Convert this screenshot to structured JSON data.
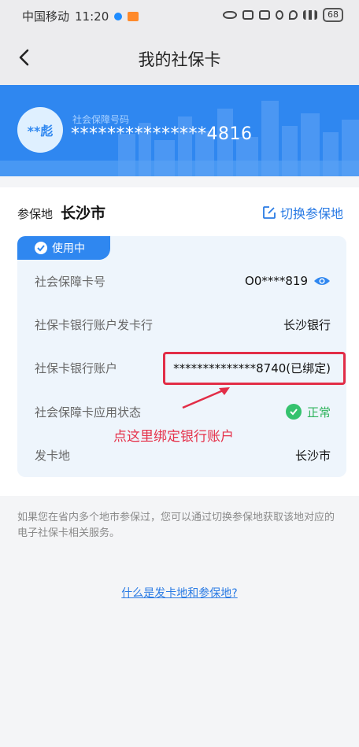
{
  "status_bar": {
    "carrier": "中国移动",
    "time": "11:20",
    "battery": "68"
  },
  "nav": {
    "title": "我的社保卡"
  },
  "banner": {
    "avatar_text": "**彪",
    "card_label": "社会保障号码",
    "card_number": "***************4816"
  },
  "insured_place": {
    "label": "参保地",
    "city": "长沙市",
    "switch_label": "切换参保地"
  },
  "card": {
    "status_tag": "使用中",
    "rows": [
      {
        "key": "社会保障卡号",
        "value": "O0****819"
      },
      {
        "key": "社保卡银行账户发卡行",
        "value": "长沙银行"
      },
      {
        "key": "社保卡银行账户",
        "value": "**************8740(已绑定)"
      },
      {
        "key": "社会保障卡应用状态",
        "value": "正常"
      },
      {
        "key": "发卡地",
        "value": "长沙市"
      }
    ]
  },
  "annotation": {
    "text": "点这里绑定银行账户",
    "color": "#e5314a"
  },
  "note": "如果您在省内多个地市参保过，您可以通过切换参保地获取该地对应的电子社保卡相关服务。",
  "help_link": "什么是发卡地和参保地?",
  "colors": {
    "primary": "#2f87f0",
    "link": "#2a7be4",
    "success": "#35c26e",
    "highlight": "#e22d47"
  }
}
